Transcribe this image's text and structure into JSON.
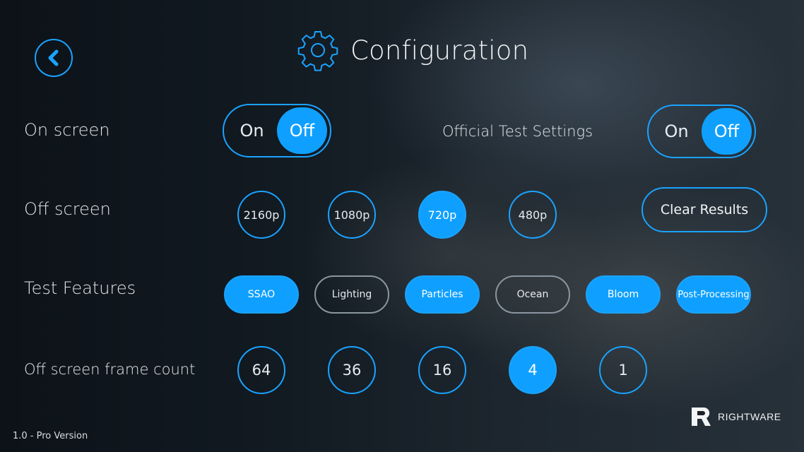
{
  "header": {
    "title": "Configuration"
  },
  "rows": {
    "on_screen": {
      "label": "On screen",
      "options": [
        "On",
        "Off"
      ],
      "selected": "Off"
    },
    "official": {
      "label": "Official Test Settings",
      "options": [
        "On",
        "Off"
      ],
      "selected": "Off"
    },
    "off_screen": {
      "label": "Off screen",
      "resolutions": [
        "2160p",
        "1080p",
        "720p",
        "480p"
      ],
      "selected": "720p"
    },
    "features": {
      "label": "Test Features",
      "items": [
        {
          "name": "SSAO",
          "enabled": true
        },
        {
          "name": "Lighting",
          "enabled": false
        },
        {
          "name": "Particles",
          "enabled": true
        },
        {
          "name": "Ocean",
          "enabled": false
        },
        {
          "name": "Bloom",
          "enabled": true
        },
        {
          "name": "Post-Processing",
          "enabled": true
        }
      ]
    },
    "frame_count": {
      "label": "Off screen frame count",
      "values": [
        "64",
        "36",
        "16",
        "4",
        "1"
      ],
      "selected": "4"
    }
  },
  "actions": {
    "clear_results": "Clear Results"
  },
  "footer": {
    "version": "1.0 - Pro Version",
    "brand": "RIGHTWARE"
  },
  "icons": {
    "back": "chevron-left-icon",
    "title": "gear-icon",
    "brand": "rightware-logo-icon"
  },
  "colors": {
    "accent": "#0fa0ff",
    "outline": "#1aa3ff",
    "inactive_outline": "#8a96a0"
  }
}
